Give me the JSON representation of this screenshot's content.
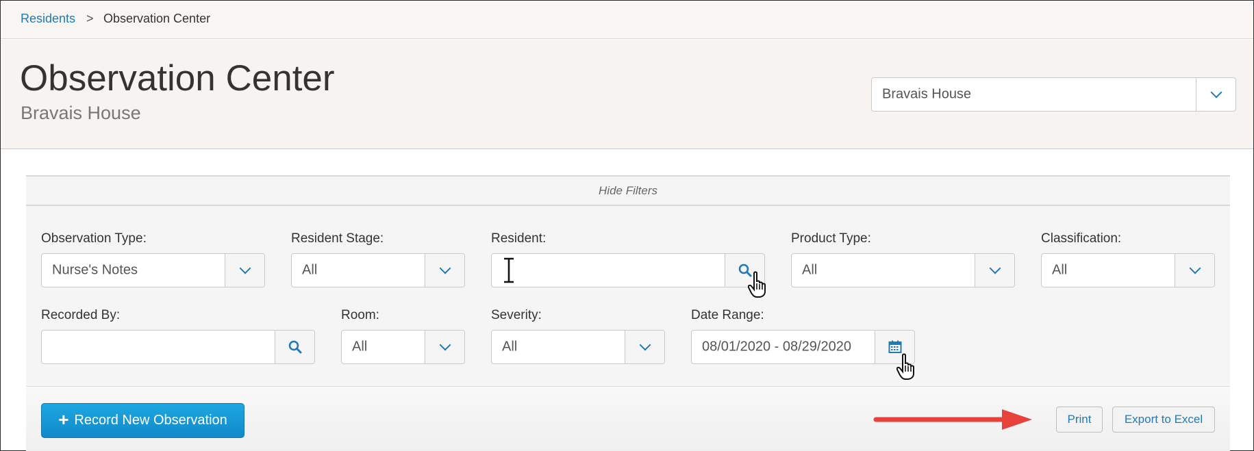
{
  "breadcrumb": {
    "link": "Residents",
    "separator": ">",
    "current": "Observation Center"
  },
  "header": {
    "title": "Observation Center",
    "subtitle": "Bravais House",
    "community_select": "Bravais House"
  },
  "filters": {
    "toggle_label": "Hide Filters",
    "observation_type": {
      "label": "Observation Type:",
      "value": "Nurse's Notes"
    },
    "resident_stage": {
      "label": "Resident Stage:",
      "value": "All"
    },
    "resident": {
      "label": "Resident:",
      "value": ""
    },
    "product_type": {
      "label": "Product Type:",
      "value": "All"
    },
    "classification": {
      "label": "Classification:",
      "value": "All"
    },
    "recorded_by": {
      "label": "Recorded By:",
      "value": ""
    },
    "room": {
      "label": "Room:",
      "value": "All"
    },
    "severity": {
      "label": "Severity:",
      "value": "All"
    },
    "date_range": {
      "label": "Date Range:",
      "value": "08/01/2020 - 08/29/2020"
    }
  },
  "actions": {
    "record_new": "Record New Observation",
    "print": "Print",
    "export": "Export to Excel"
  },
  "colors": {
    "accent": "#1f7ab5",
    "primary_button": "#1a9ad6",
    "annotation_arrow": "#e8403a"
  }
}
